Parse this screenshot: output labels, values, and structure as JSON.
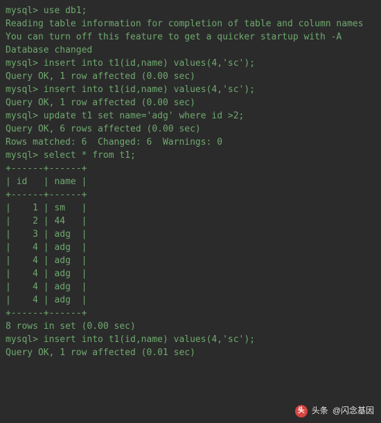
{
  "prompt": "mysql>",
  "lines": [
    "mysql> use db1;",
    "Reading table information for completion of table and column names",
    "You can turn off this feature to get a quicker startup with -A",
    "",
    "Database changed",
    "mysql> insert into t1(id,name) values(4,'sc');",
    "Query OK, 1 row affected (0.00 sec)",
    "",
    "mysql> insert into t1(id,name) values(4,'sc');",
    "Query OK, 1 row affected (0.00 sec)",
    "",
    "mysql> update t1 set name='adg' where id >2;",
    "Query OK, 6 rows affected (0.00 sec)",
    "Rows matched: 6  Changed: 6  Warnings: 0",
    "",
    "mysql> select * from t1;",
    "+------+------+",
    "| id   | name |",
    "+------+------+",
    "|    1 | sm   |",
    "|    2 | 44   |",
    "|    3 | adg  |",
    "|    4 | adg  |",
    "|    4 | adg  |",
    "|    4 | adg  |",
    "|    4 | adg  |",
    "|    4 | adg  |",
    "+------+------+",
    "8 rows in set (0.00 sec)",
    "",
    "mysql> insert into t1(id,name) values(4,'sc');",
    "Query OK, 1 row affected (0.01 sec)"
  ],
  "commands": [
    "use db1;",
    "insert into t1(id,name) values(4,'sc');",
    "insert into t1(id,name) values(4,'sc');",
    "update t1 set name='adg' where id >2;",
    "select * from t1;",
    "insert into t1(id,name) values(4,'sc');"
  ],
  "query_result_table": {
    "columns": [
      "id",
      "name"
    ],
    "rows": [
      [
        1,
        "sm"
      ],
      [
        2,
        "44"
      ],
      [
        3,
        "adg"
      ],
      [
        4,
        "adg"
      ],
      [
        4,
        "adg"
      ],
      [
        4,
        "adg"
      ],
      [
        4,
        "adg"
      ],
      [
        4,
        "adg"
      ]
    ],
    "row_count": 8,
    "elapsed": "0.00 sec"
  },
  "watermark": {
    "prefix": "头条",
    "author": "@闪念基因",
    "icon_letter": "头"
  }
}
